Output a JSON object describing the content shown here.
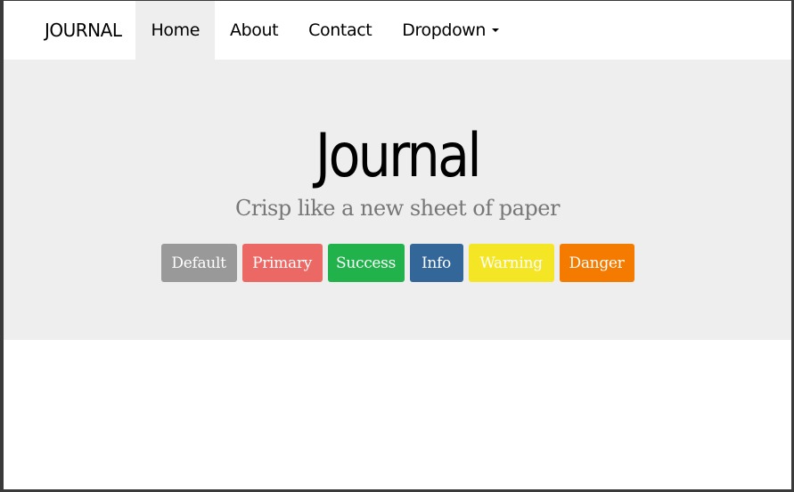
{
  "navbar": {
    "brand": "JOURNAL",
    "items": [
      {
        "label": "Home",
        "active": true
      },
      {
        "label": "About",
        "active": false
      },
      {
        "label": "Contact",
        "active": false
      },
      {
        "label": "Dropdown",
        "active": false
      }
    ]
  },
  "jumbotron": {
    "title": "Journal",
    "subtitle": "Crisp like a new sheet of paper"
  },
  "buttons": [
    {
      "label": "Default",
      "color": "#999999"
    },
    {
      "label": "Primary",
      "color": "#eb6864"
    },
    {
      "label": "Success",
      "color": "#22b24c"
    },
    {
      "label": "Info",
      "color": "#336699"
    },
    {
      "label": "Warning",
      "color": "#f5e625"
    },
    {
      "label": "Danger",
      "color": "#f57a00"
    }
  ],
  "icons": {
    "dropdown_caret": "caret-down-icon"
  },
  "colors": {
    "jumbotron_background": "#eeeeee",
    "active_nav_background": "#eeeeee",
    "subtitle_text": "#777777"
  }
}
